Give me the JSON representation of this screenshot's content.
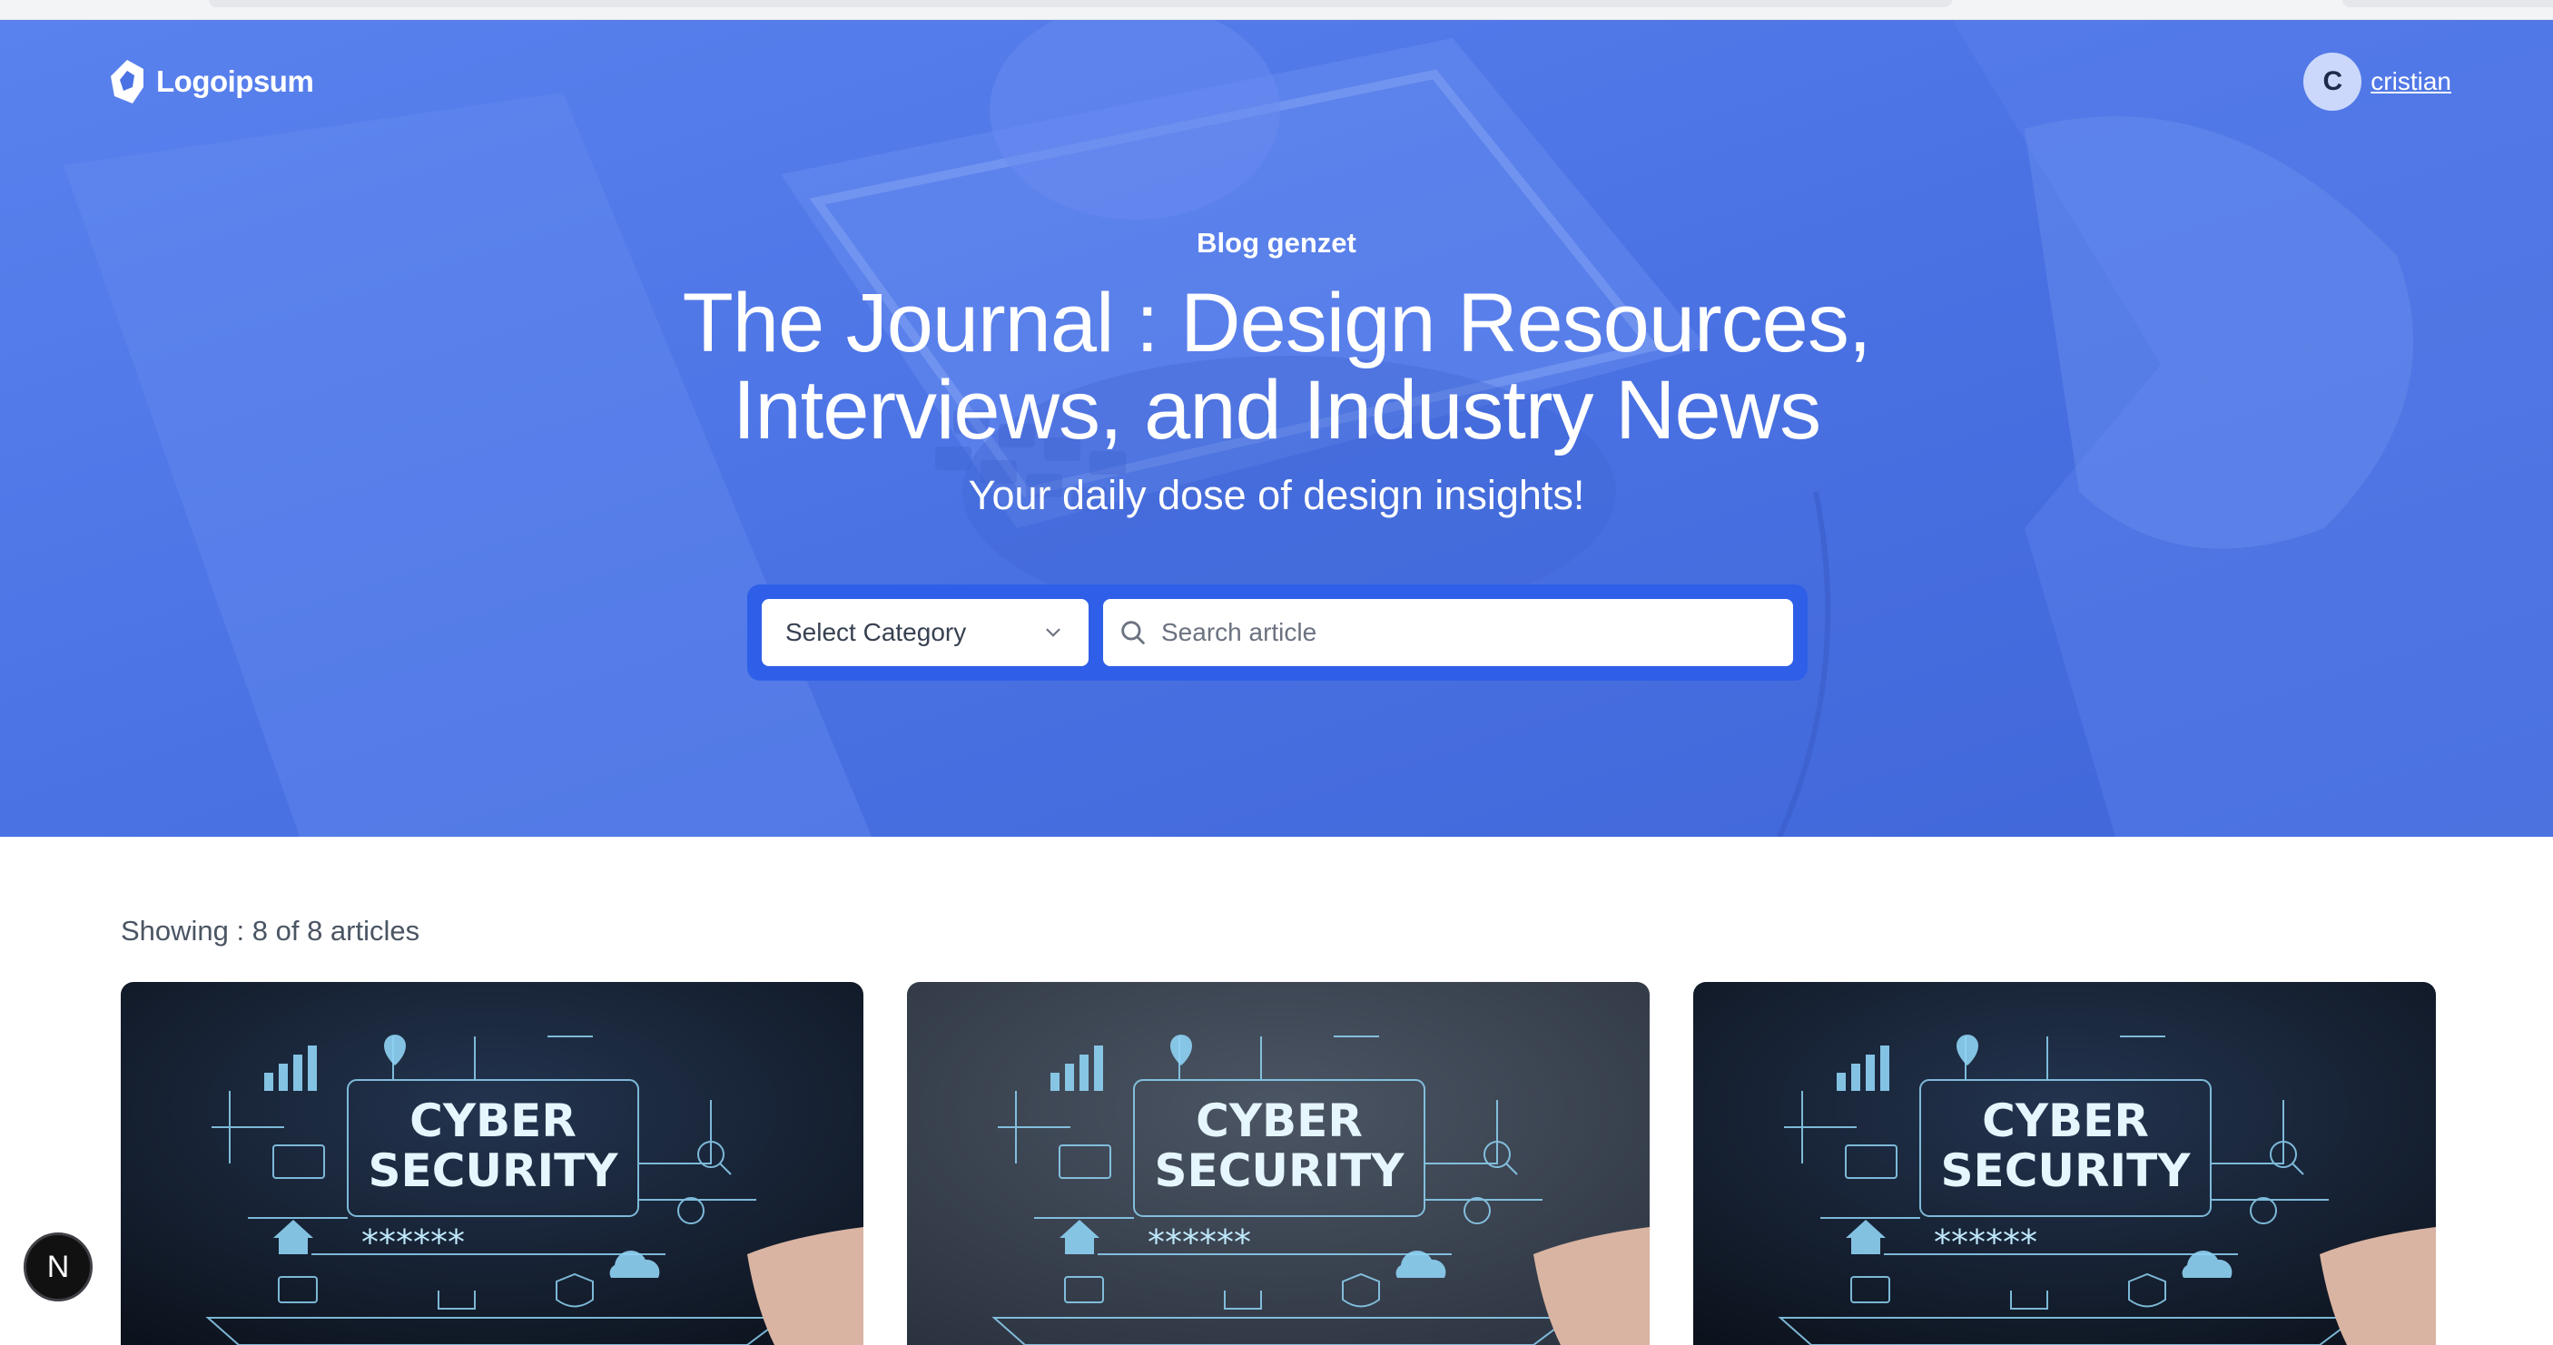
{
  "header": {
    "logo_text": "Logoipsum",
    "user_initial": "C",
    "user_name": "cristian"
  },
  "hero": {
    "eyebrow": "Blog genzet",
    "title_line1": "The Journal : Design Resources,",
    "title_line2": "Interviews, and Industry News",
    "subtitle": "Your daily dose of design insights!",
    "accent_color": "#4a72e3"
  },
  "filters": {
    "category_select": "Select Category",
    "search_placeholder": "Search article"
  },
  "results": {
    "showing_text": "Showing : 8 of 8 articles"
  },
  "articles": [
    {
      "image_title_1": "CYBER",
      "image_title_2": "SECURITY",
      "image_mask": "******",
      "bg": "dark"
    },
    {
      "image_title_1": "CYBER",
      "image_title_2": "SECURITY",
      "image_mask": "******",
      "bg": "gray"
    },
    {
      "image_title_1": "CYBER",
      "image_title_2": "SECURITY",
      "image_mask": "******",
      "bg": "dark"
    }
  ],
  "dev_badge": {
    "label": "N"
  }
}
